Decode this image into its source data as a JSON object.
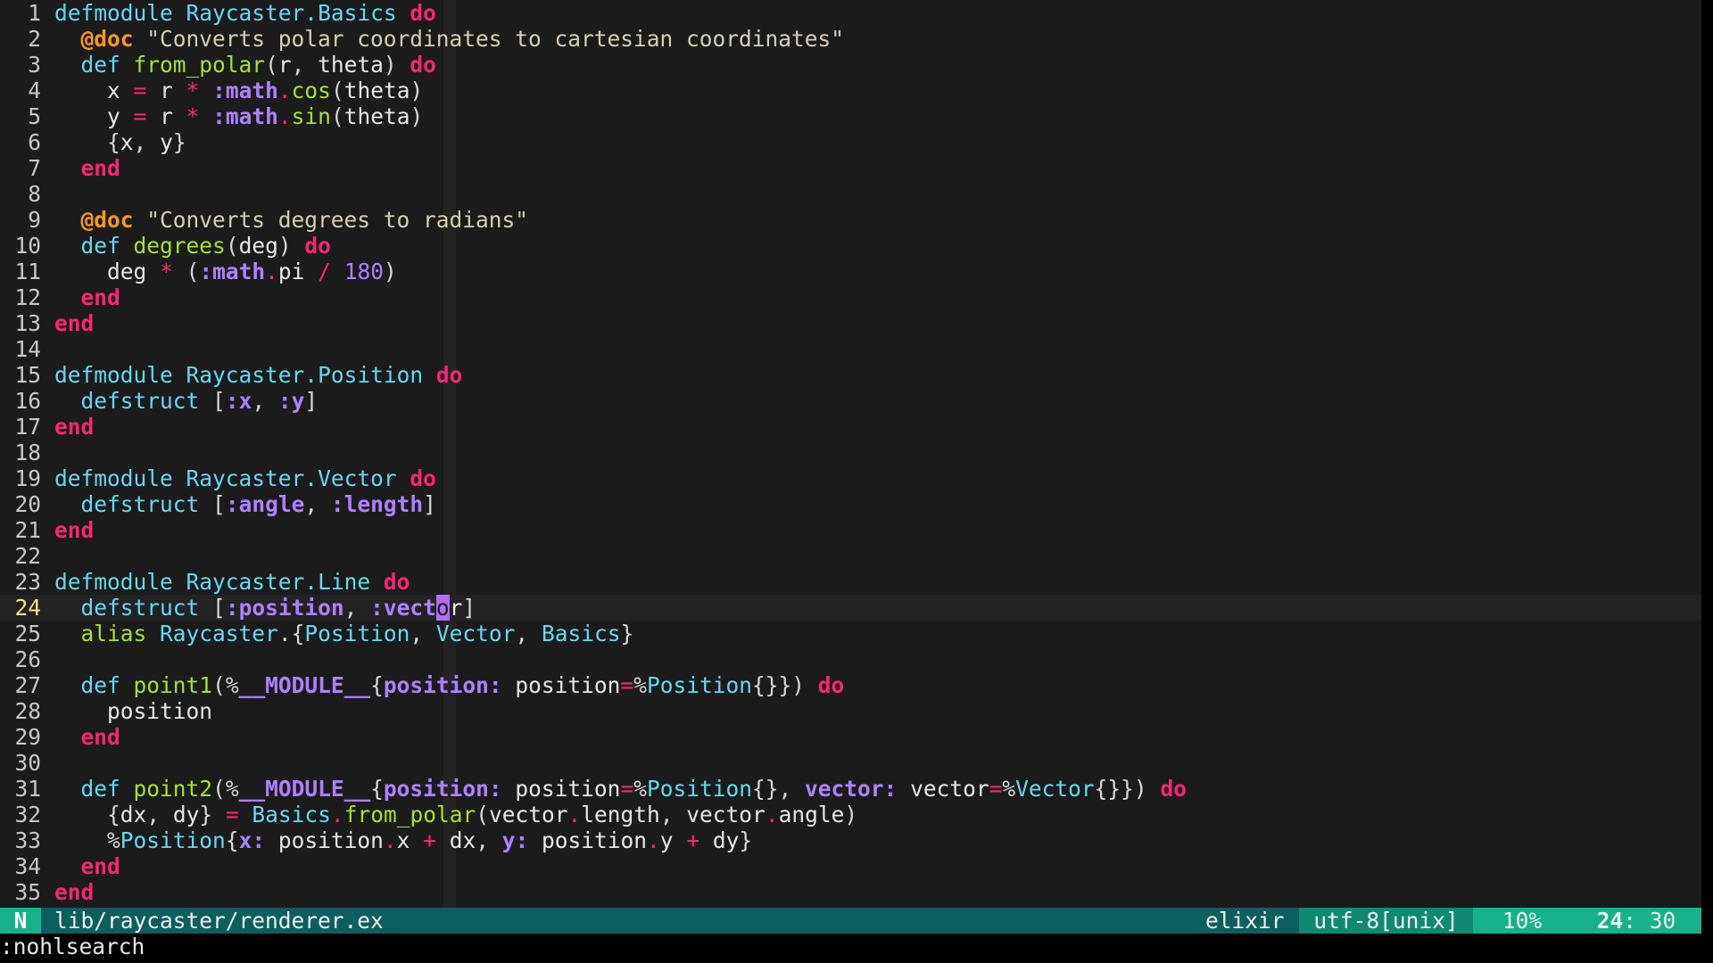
{
  "editor": {
    "cursor_line": 24,
    "lines": [
      "defmodule Raycaster.Basics do",
      "  @doc \"Converts polar coordinates to cartesian coordinates\"",
      "  def from_polar(r, theta) do",
      "    x = r * :math.cos(theta)",
      "    y = r * :math.sin(theta)",
      "    {x, y}",
      "  end",
      "",
      "  @doc \"Converts degrees to radians\"",
      "  def degrees(deg) do",
      "    deg * (:math.pi / 180)",
      "  end",
      "end",
      "",
      "defmodule Raycaster.Position do",
      "  defstruct [:x, :y]",
      "end",
      "",
      "defmodule Raycaster.Vector do",
      "  defstruct [:angle, :length]",
      "end",
      "",
      "defmodule Raycaster.Line do",
      "  defstruct [:position, :vector]",
      "  alias Raycaster.{Position, Vector, Basics}",
      "",
      "  def point1(%__MODULE__{position: position=%Position{}}) do",
      "    position",
      "  end",
      "",
      "  def point2(%__MODULE__{position: position=%Position{}, vector: vector=%Vector{}}) do",
      "    {dx, dy} = Basics.from_polar(vector.length, vector.angle)",
      "    %Position{x: position.x + dx, y: position.y + dy}",
      "  end",
      "end"
    ]
  },
  "statusline": {
    "mode": "N",
    "file_path": "lib/raycaster/renderer.ex",
    "filetype": "elixir",
    "encoding": "utf-8[unix]",
    "percent": "10%",
    "line": "24",
    "column": "30"
  },
  "cmdline": {
    "text": ":nohlsearch"
  },
  "colors": {
    "background": "#1b1b1b",
    "keyword": "#f92672",
    "definition": "#66d9ef",
    "function": "#a6e22e",
    "atom": "#ae81ff",
    "attribute": "#fd971f",
    "string": "#d5d0b0",
    "statusline": "#0b5f5f",
    "mode_accent": "#17b28a"
  }
}
